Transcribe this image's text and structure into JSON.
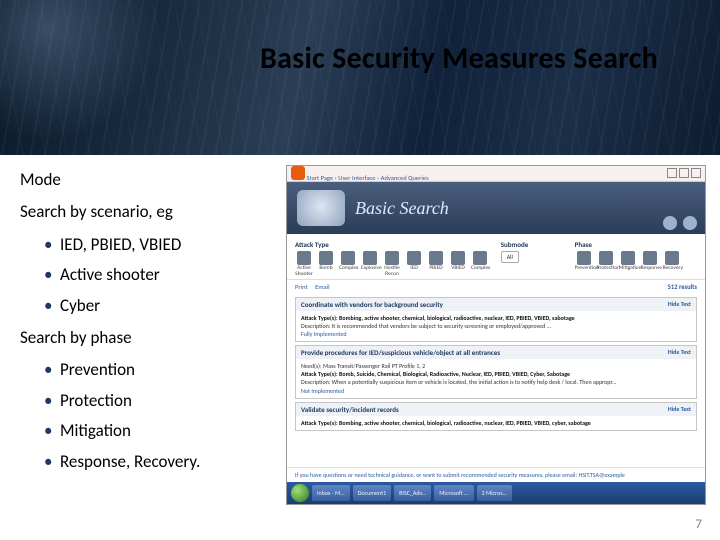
{
  "title": "Basic Security Measures Search",
  "left": {
    "mode": "Mode",
    "search_by_scenario": "Search by scenario, eg",
    "scenario_items": [
      "IED, PBIED, VBIED",
      "Active shooter",
      "Cyber"
    ],
    "search_by_phase": "Search by phase",
    "phase_items": [
      "Prevention",
      "Protection",
      "Mitigation",
      "Response, Recovery."
    ]
  },
  "page_number": "7",
  "shot": {
    "breadcrumb": "Start Page › User Interface › Advanced Queries",
    "ribbon_title": "Basic Search",
    "filters": {
      "attack_label": "Attack Type",
      "submode_label": "Submode",
      "phase_label": "Phase",
      "attack_icons": [
        "Active Shooter",
        "Bomb",
        "Complex",
        "Explosive",
        "Hostile Recon",
        "IED",
        "PBIED",
        "VBIED",
        "Complex"
      ],
      "phase_icons": [
        "Prevention",
        "Protection",
        "Mitigation",
        "Response",
        "Recovery"
      ],
      "all_chip": "All"
    },
    "toolbar": {
      "print": "Print",
      "email": "Email",
      "results": "512 results"
    },
    "cards": [
      {
        "heading": "Coordinate with vendors for background security",
        "hide": "Hide Text",
        "body": [
          "Attack Type(s): Bombing, active shooter, chemical, biological, radioactive, nuclear, IED, PBIED, VBIED, sabotage",
          "Description: It is recommended that vendors be subject to security screening or employed/approved ...",
          "Fully Implemented"
        ]
      },
      {
        "heading": "Provide procedures for IED/suspicious vehicle/object at all entrances",
        "hide": "Hide Text",
        "body": [
          "Need(s): Mass Transit/Passenger Rail PT Profile 1, 2",
          "Attack Type(s): Bomb, Suicide, Chemical, Biological, Radioactive, Nuclear, IED, PBIED, VBIED, Cyber, Sabotage",
          "Description: When a potentially suspicious item or vehicle is located, the initial action is to notify help desk / local. Then appropr...",
          "Not Implemented"
        ]
      },
      {
        "heading": "Validate security/incident records",
        "hide": "Hide Text",
        "body": [
          "Attack Type(s): Bombing, active shooter, chemical, biological, radioactive, nuclear, IED, PBIED, VBIED, cyber, sabotage"
        ]
      }
    ],
    "footer": "If you have questions or need technical guidance, or want to submit recommended security measures, please email:  HSIT.TSA@example",
    "taskbar": [
      "Inbox - M...",
      "Document1",
      "BISC_Adv...",
      "Microsoft ...",
      "2 Micros..."
    ]
  }
}
